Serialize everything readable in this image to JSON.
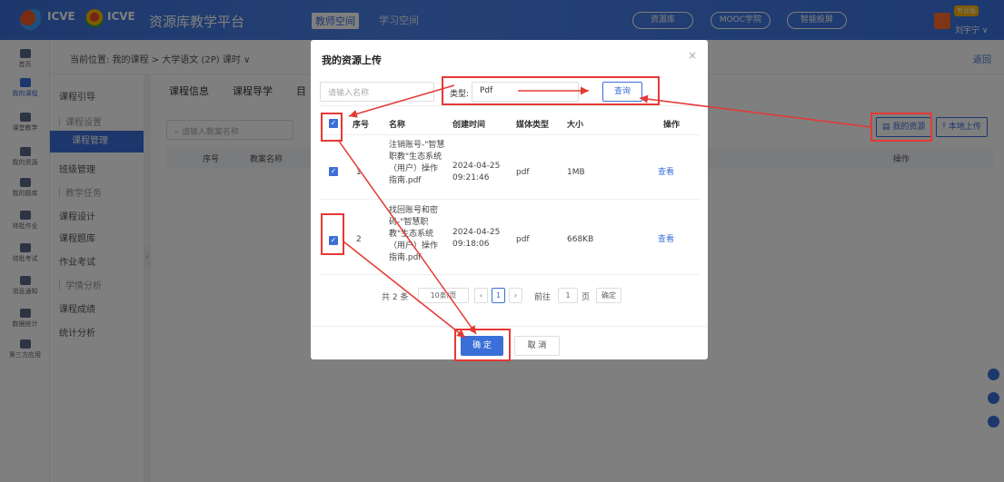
{
  "topbar": {
    "brand1": "ICVE",
    "brand2": "ICVE",
    "platform": "资源库教学平台",
    "nav": [
      "教师空间",
      "学习空间"
    ],
    "links": [
      "资源库",
      "MOOC学院",
      "智能投屏"
    ],
    "user_badge": "专业版",
    "user_name": "刘宇宁 ∨"
  },
  "left_nav": [
    {
      "label": "首页"
    },
    {
      "label": "我的课程"
    },
    {
      "label": "课堂教学"
    },
    {
      "label": "我的资源"
    },
    {
      "label": "我的题库"
    },
    {
      "label": "待批作业"
    },
    {
      "label": "待批考试"
    },
    {
      "label": "消息通知"
    },
    {
      "label": "数据统计"
    },
    {
      "label": "第三方应用"
    }
  ],
  "sub_nav": {
    "guide": "课程引导",
    "sections": [
      {
        "head": "课程设置",
        "items": [
          "课程管理",
          "班级管理"
        ]
      },
      {
        "head": "教学任务",
        "items": [
          "课程设计",
          "课程题库",
          "作业考试"
        ]
      },
      {
        "head": "学情分析",
        "items": [
          "课程成绩",
          "统计分析"
        ]
      }
    ]
  },
  "breadcrumb": "当前位置: 我的课程 > 大学语文 (2P) 课时 ∨",
  "back": "返回",
  "main_tabs": [
    "课程信息",
    "课程导学",
    "目"
  ],
  "main_search_placeholder": "请输入教案名称",
  "main_table_headers": [
    "序号",
    "教案名称",
    "操作"
  ],
  "main_buttons": {
    "my_resources": "我的资源",
    "local_upload": "本地上传"
  },
  "modal": {
    "title": "我的资源上传",
    "close": "×",
    "name_placeholder": "请输入名称",
    "type_label": "类型:",
    "type_value": "Pdf",
    "query": "查询",
    "headers": [
      "序号",
      "名称",
      "创建时间",
      "媒体类型",
      "大小",
      "操作"
    ],
    "rows": [
      {
        "index": "1",
        "name": "注销账号-\"智慧职教\"生态系统（用户）操作指南.pdf",
        "created": "2024-04-25 09:21:46",
        "media": "pdf",
        "size": "1MB",
        "action": "查看"
      },
      {
        "index": "2",
        "name": "找回账号和密码-\"智慧职教\"生态系统（用户）操作指南.pdf",
        "created": "2024-04-25 09:18:06",
        "media": "pdf",
        "size": "668KB",
        "action": "查看"
      }
    ],
    "pagination": {
      "total": "共 2 条",
      "page_size": "10条/页",
      "current": "1",
      "goto_label": "前往",
      "goto_value": "1",
      "page_unit": "页",
      "confirm": "确定"
    },
    "ok": "确 定",
    "cancel": "取 消"
  }
}
